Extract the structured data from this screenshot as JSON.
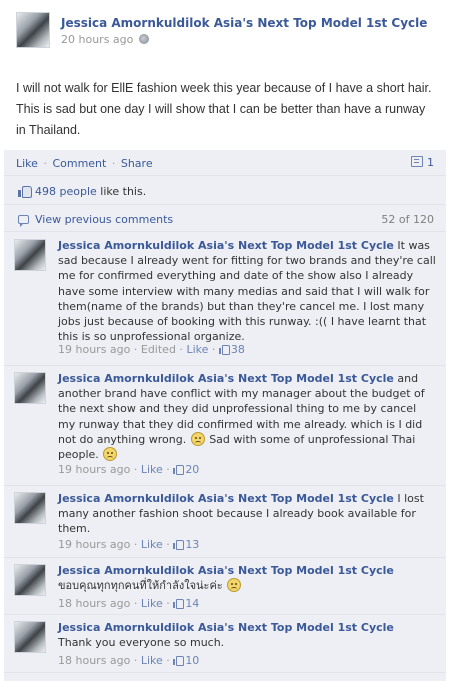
{
  "post": {
    "author": "Jessica Amornkuldilok Asia's Next Top Model 1st Cycle",
    "timestamp": "20 hours ago",
    "privacy_icon": "globe-icon",
    "text": "I will not walk for EllE fashion week this year because of I have a short hair. This is sad but one day I will show that I can be better than have a runway in Thailand."
  },
  "actions": {
    "like": "Like",
    "comment": "Comment",
    "share": "Share",
    "separator": "·",
    "comment_count": "1"
  },
  "likes": {
    "count_text": "498 people",
    "suffix": " like this."
  },
  "previous": {
    "label": "View previous comments",
    "pager": "52 of 120"
  },
  "comments": [
    {
      "name": "Jessica Amornkuldilok Asia's Next Top Model 1st Cycle",
      "text": " It was sad because I already went for fitting for two brands and they're call me for confirmed everything and date of the show also I already have some interview with many medias and said that I will walk for them(name of the brands) but than they're cancel me. I lost many jobs just because of booking with this runway. :(( I have learnt that this is so unprofessional organize.",
      "time": "19 hours ago",
      "edited": "Edited",
      "like": "Like",
      "likes": "38"
    },
    {
      "name": "Jessica Amornkuldilok Asia's Next Top Model 1st Cycle",
      "text": " and another brand have conflict with my manager about the budget of the next show and they did unprofessional thing to me by cancel my runway that they did confirmed with me already. which is I did not do anything wrong.",
      "text2": " Sad with some of unprofessional Thai people.",
      "time": "19 hours ago",
      "like": "Like",
      "likes": "20"
    },
    {
      "name": "Jessica Amornkuldilok Asia's Next Top Model 1st Cycle",
      "text": " I lost many another fashion shoot because I already book available for them.",
      "time": "19 hours ago",
      "like": "Like",
      "likes": "13"
    },
    {
      "name": "Jessica Amornkuldilok Asia's Next Top Model 1st Cycle",
      "text": "ขอบคุณทุกทุกคนที่ให้กำลังใจน่ะค่ะ",
      "time": "18 hours ago",
      "like": "Like",
      "likes": "14"
    },
    {
      "name": "Jessica Amornkuldilok Asia's Next Top Model 1st Cycle",
      "text": "Thank you everyone so much.",
      "time": "18 hours ago",
      "like": "Like",
      "likes": "10"
    }
  ]
}
